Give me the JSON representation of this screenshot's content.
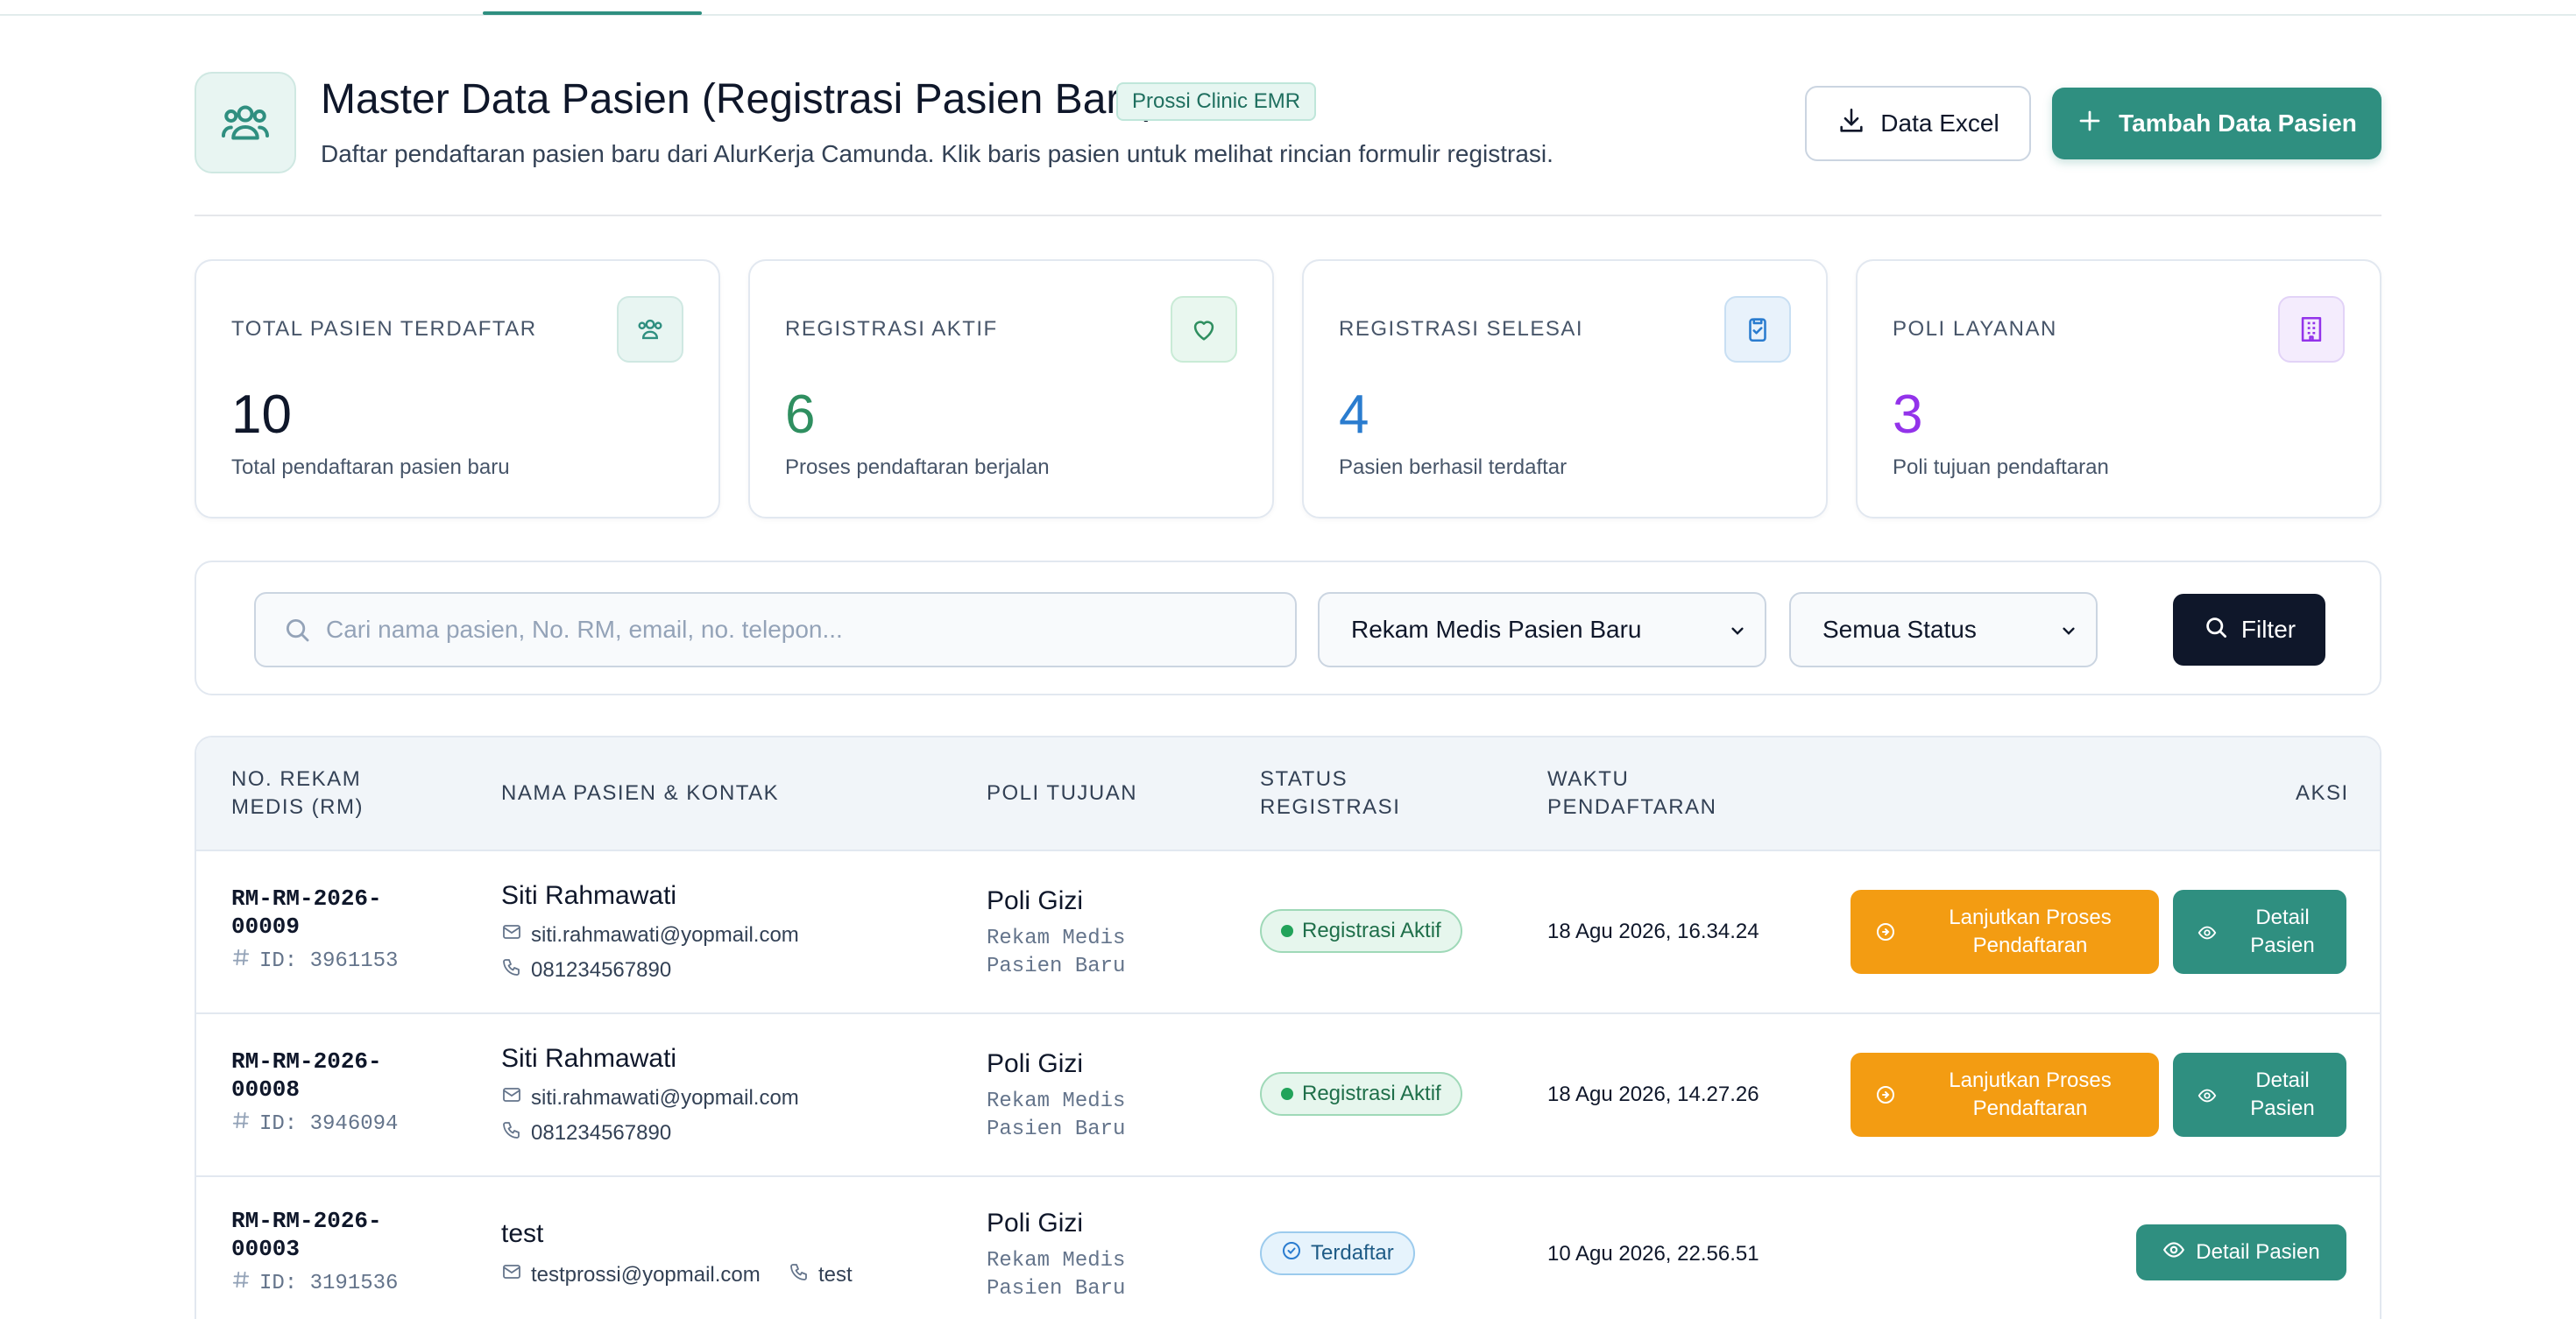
{
  "header": {
    "title": "Master Data Pasien (Registrasi Pasien Baru)",
    "badge": "Prossi Clinic EMR",
    "subtitle": "Daftar pendaftaran pasien baru dari AlurKerja Camunda. Klik baris pasien untuk melihat rincian formulir registrasi.",
    "excel_label": "Data Excel",
    "add_label": "Tambah Data Pasien"
  },
  "stats": [
    {
      "label": "TOTAL PASIEN TERDAFTAR",
      "value": "10",
      "desc": "Total pendaftaran pasien baru",
      "color": "#0f172a",
      "icon": "users-icon"
    },
    {
      "label": "REGISTRASI AKTIF",
      "value": "6",
      "desc": "Proses pendaftaran berjalan",
      "color": "#2f8f60",
      "icon": "heart-icon"
    },
    {
      "label": "REGISTRASI SELESAI",
      "value": "4",
      "desc": "Pasien berhasil terdaftar",
      "color": "#2a7ccf",
      "icon": "clipboard-check-icon"
    },
    {
      "label": "POLI LAYANAN",
      "value": "3",
      "desc": "Poli tujuan pendaftaran",
      "color": "#9333ea",
      "icon": "building-icon"
    }
  ],
  "filter": {
    "search_placeholder": "Cari nama pasien, No. RM, email, no. telepon...",
    "record_type": "Rekam Medis Pasien Baru",
    "status": "Semua Status",
    "filter_label": "Filter"
  },
  "table": {
    "headers": {
      "rm_1": "NO. REKAM",
      "rm_2": "MEDIS (RM)",
      "name": "NAMA PASIEN & KONTAK",
      "poli": "POLI TUJUAN",
      "status_1": "STATUS",
      "status_2": "REGISTRASI",
      "time_1": "WAKTU",
      "time_2": "PENDAFTARAN",
      "action": "AKSI"
    },
    "rows": [
      {
        "rm_1": "RM-RM-2026-",
        "rm_2": "00009",
        "id": "ID: 3961153",
        "name": "Siti Rahmawati",
        "email": "siti.rahmawati@yopmail.com",
        "phone": "081234567890",
        "poli": "Poli Gizi",
        "poli_sub_1": "Rekam Medis",
        "poli_sub_2": "Pasien Baru",
        "status": "Registrasi Aktif",
        "time": "18 Agu 2026, 16.34.24",
        "continue_1": "Lanjutkan Proses",
        "continue_2": "Pendaftaran",
        "detail_1": "Detail",
        "detail_2": "Pasien"
      },
      {
        "rm_1": "RM-RM-2026-",
        "rm_2": "00008",
        "id": "ID: 3946094",
        "name": "Siti Rahmawati",
        "email": "siti.rahmawati@yopmail.com",
        "phone": "081234567890",
        "poli": "Poli Gizi",
        "poli_sub_1": "Rekam Medis",
        "poli_sub_2": "Pasien Baru",
        "status": "Registrasi Aktif",
        "time": "18 Agu 2026, 14.27.26",
        "continue_1": "Lanjutkan Proses",
        "continue_2": "Pendaftaran",
        "detail_1": "Detail",
        "detail_2": "Pasien"
      },
      {
        "rm_1": "RM-RM-2026-",
        "rm_2": "00003",
        "id": "ID: 3191536",
        "name": "test",
        "email": "testprossi@yopmail.com",
        "phone": "test",
        "poli": "Poli Gizi",
        "poli_sub_1": "Rekam Medis",
        "poli_sub_2": "Pasien Baru",
        "status": "Terdaftar",
        "time": "10 Agu 2026, 22.56.51",
        "detail_label": "Detail Pasien"
      }
    ]
  },
  "colors": {
    "accent": "#2f8f80",
    "warning": "#f39c12",
    "dark": "#0f172a"
  }
}
